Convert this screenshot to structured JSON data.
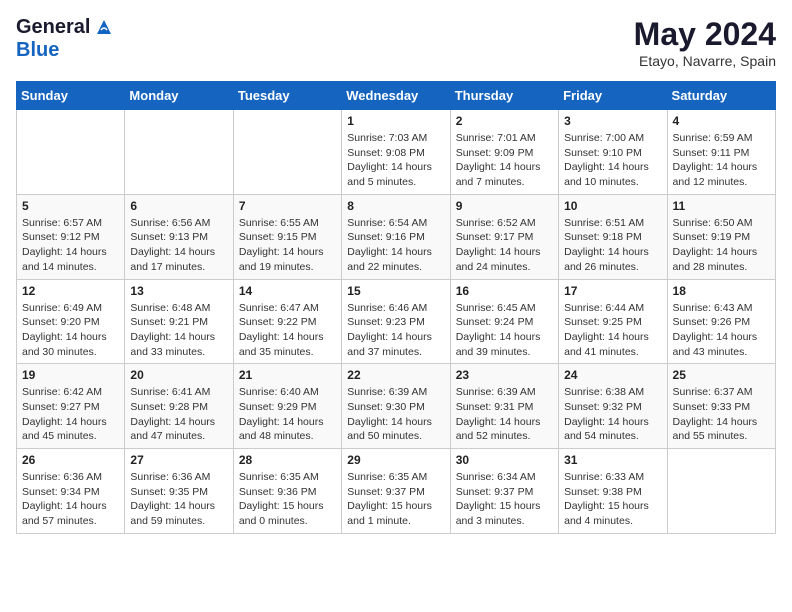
{
  "header": {
    "logo_line1": "General",
    "logo_line2": "Blue",
    "title": "May 2024",
    "subtitle": "Etayo, Navarre, Spain"
  },
  "weekdays": [
    "Sunday",
    "Monday",
    "Tuesday",
    "Wednesday",
    "Thursday",
    "Friday",
    "Saturday"
  ],
  "weeks": [
    [
      {
        "day": "",
        "info": ""
      },
      {
        "day": "",
        "info": ""
      },
      {
        "day": "",
        "info": ""
      },
      {
        "day": "1",
        "info": "Sunrise: 7:03 AM\nSunset: 9:08 PM\nDaylight: 14 hours\nand 5 minutes."
      },
      {
        "day": "2",
        "info": "Sunrise: 7:01 AM\nSunset: 9:09 PM\nDaylight: 14 hours\nand 7 minutes."
      },
      {
        "day": "3",
        "info": "Sunrise: 7:00 AM\nSunset: 9:10 PM\nDaylight: 14 hours\nand 10 minutes."
      },
      {
        "day": "4",
        "info": "Sunrise: 6:59 AM\nSunset: 9:11 PM\nDaylight: 14 hours\nand 12 minutes."
      }
    ],
    [
      {
        "day": "5",
        "info": "Sunrise: 6:57 AM\nSunset: 9:12 PM\nDaylight: 14 hours\nand 14 minutes."
      },
      {
        "day": "6",
        "info": "Sunrise: 6:56 AM\nSunset: 9:13 PM\nDaylight: 14 hours\nand 17 minutes."
      },
      {
        "day": "7",
        "info": "Sunrise: 6:55 AM\nSunset: 9:15 PM\nDaylight: 14 hours\nand 19 minutes."
      },
      {
        "day": "8",
        "info": "Sunrise: 6:54 AM\nSunset: 9:16 PM\nDaylight: 14 hours\nand 22 minutes."
      },
      {
        "day": "9",
        "info": "Sunrise: 6:52 AM\nSunset: 9:17 PM\nDaylight: 14 hours\nand 24 minutes."
      },
      {
        "day": "10",
        "info": "Sunrise: 6:51 AM\nSunset: 9:18 PM\nDaylight: 14 hours\nand 26 minutes."
      },
      {
        "day": "11",
        "info": "Sunrise: 6:50 AM\nSunset: 9:19 PM\nDaylight: 14 hours\nand 28 minutes."
      }
    ],
    [
      {
        "day": "12",
        "info": "Sunrise: 6:49 AM\nSunset: 9:20 PM\nDaylight: 14 hours\nand 30 minutes."
      },
      {
        "day": "13",
        "info": "Sunrise: 6:48 AM\nSunset: 9:21 PM\nDaylight: 14 hours\nand 33 minutes."
      },
      {
        "day": "14",
        "info": "Sunrise: 6:47 AM\nSunset: 9:22 PM\nDaylight: 14 hours\nand 35 minutes."
      },
      {
        "day": "15",
        "info": "Sunrise: 6:46 AM\nSunset: 9:23 PM\nDaylight: 14 hours\nand 37 minutes."
      },
      {
        "day": "16",
        "info": "Sunrise: 6:45 AM\nSunset: 9:24 PM\nDaylight: 14 hours\nand 39 minutes."
      },
      {
        "day": "17",
        "info": "Sunrise: 6:44 AM\nSunset: 9:25 PM\nDaylight: 14 hours\nand 41 minutes."
      },
      {
        "day": "18",
        "info": "Sunrise: 6:43 AM\nSunset: 9:26 PM\nDaylight: 14 hours\nand 43 minutes."
      }
    ],
    [
      {
        "day": "19",
        "info": "Sunrise: 6:42 AM\nSunset: 9:27 PM\nDaylight: 14 hours\nand 45 minutes."
      },
      {
        "day": "20",
        "info": "Sunrise: 6:41 AM\nSunset: 9:28 PM\nDaylight: 14 hours\nand 47 minutes."
      },
      {
        "day": "21",
        "info": "Sunrise: 6:40 AM\nSunset: 9:29 PM\nDaylight: 14 hours\nand 48 minutes."
      },
      {
        "day": "22",
        "info": "Sunrise: 6:39 AM\nSunset: 9:30 PM\nDaylight: 14 hours\nand 50 minutes."
      },
      {
        "day": "23",
        "info": "Sunrise: 6:39 AM\nSunset: 9:31 PM\nDaylight: 14 hours\nand 52 minutes."
      },
      {
        "day": "24",
        "info": "Sunrise: 6:38 AM\nSunset: 9:32 PM\nDaylight: 14 hours\nand 54 minutes."
      },
      {
        "day": "25",
        "info": "Sunrise: 6:37 AM\nSunset: 9:33 PM\nDaylight: 14 hours\nand 55 minutes."
      }
    ],
    [
      {
        "day": "26",
        "info": "Sunrise: 6:36 AM\nSunset: 9:34 PM\nDaylight: 14 hours\nand 57 minutes."
      },
      {
        "day": "27",
        "info": "Sunrise: 6:36 AM\nSunset: 9:35 PM\nDaylight: 14 hours\nand 59 minutes."
      },
      {
        "day": "28",
        "info": "Sunrise: 6:35 AM\nSunset: 9:36 PM\nDaylight: 15 hours\nand 0 minutes."
      },
      {
        "day": "29",
        "info": "Sunrise: 6:35 AM\nSunset: 9:37 PM\nDaylight: 15 hours\nand 1 minute."
      },
      {
        "day": "30",
        "info": "Sunrise: 6:34 AM\nSunset: 9:37 PM\nDaylight: 15 hours\nand 3 minutes."
      },
      {
        "day": "31",
        "info": "Sunrise: 6:33 AM\nSunset: 9:38 PM\nDaylight: 15 hours\nand 4 minutes."
      },
      {
        "day": "",
        "info": ""
      }
    ]
  ]
}
